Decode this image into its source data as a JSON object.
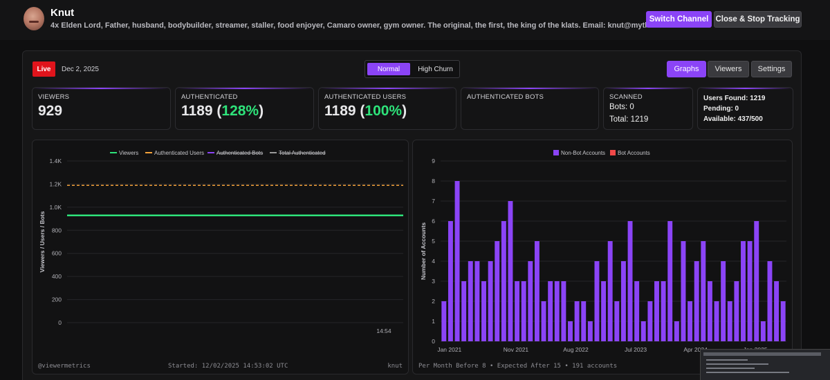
{
  "header": {
    "channel_name": "Knut",
    "bio": "4x Elden Lord, Father, husband, bodybuilder, streamer, staller, food enjoyer, Camaro owner, gym owner. The original, the first, the king of the klats. Email: knut@mythictalent.com",
    "switch_label": "Switch Channel",
    "close_label": "Close & Stop Tracking"
  },
  "status": {
    "live_label": "Live",
    "date": "Dec 2, 2025"
  },
  "mode": {
    "normal": "Normal",
    "high_churn": "High Churn",
    "selected": "Normal"
  },
  "tabs": [
    {
      "label": "Graphs",
      "active": true
    },
    {
      "label": "Viewers"
    },
    {
      "label": "Settings"
    }
  ],
  "stats": {
    "viewers": {
      "label": "VIEWERS",
      "value": "929"
    },
    "authenticated": {
      "label": "AUTHENTICATED",
      "value": "1189",
      "pct": "128%"
    },
    "authenticated_users": {
      "label": "AUTHENTICATED USERS",
      "value": "1189",
      "pct": "100%"
    },
    "authenticated_bots": {
      "label": "AUTHENTICATED BOTS",
      "value": ""
    },
    "scanned": {
      "label": "SCANNED",
      "bots": "Bots: 0",
      "total": "Total: 1219"
    },
    "users": {
      "found": "Users Found: 1219",
      "pending": "Pending: 0",
      "available": "Available: 437/500"
    }
  },
  "colors": {
    "accent": "#8b44f7",
    "live": "#e0141c",
    "green": "#2ee37a",
    "orange": "#f5a33b",
    "red": "#f04848",
    "grey": "#9a9a9a"
  },
  "chart_data": [
    {
      "type": "line",
      "legend": [
        "Viewers",
        "Authenticated Users",
        "Authenticated Bots",
        "Total Authenticated"
      ],
      "legend_struck": [
        false,
        false,
        true,
        true
      ],
      "legend_position": "top",
      "ylabel": "Viewers / Users / Bots",
      "yticks": [
        "0",
        "200",
        "400",
        "600",
        "800",
        "1.0K",
        "1.2K",
        "1.4K"
      ],
      "ylim": [
        0,
        1400
      ],
      "xtick": "14:54",
      "series": [
        {
          "name": "Viewers",
          "value": 929,
          "color": "#2ee37a",
          "style": "solid"
        },
        {
          "name": "Authenticated Users",
          "value": 1189,
          "color": "#f5a33b",
          "style": "dashed"
        }
      ],
      "grid": true,
      "footer": {
        "left": "@viewermetrics",
        "center": "Started: 12/02/2025 14:53:02 UTC",
        "right": "knut"
      }
    },
    {
      "type": "bar",
      "legend": [
        "Non-Bot Accounts",
        "Bot Accounts"
      ],
      "legend_colors": [
        "#8b44f7",
        "#f04848"
      ],
      "legend_position": "top",
      "ylabel": "Number of Accounts",
      "ylim": [
        0,
        9
      ],
      "yticks": [
        "0",
        "1",
        "2",
        "3",
        "4",
        "5",
        "6",
        "7",
        "8",
        "9"
      ],
      "xticks": [
        "Jan 2021",
        "Nov 2021",
        "Aug 2022",
        "Jul 2023",
        "Apr 2024",
        "Jan 2025"
      ],
      "xtick_indices": [
        0,
        10,
        19,
        28,
        37,
        46
      ],
      "values": [
        2,
        6,
        8,
        3,
        4,
        4,
        3,
        4,
        5,
        6,
        7,
        3,
        3,
        4,
        5,
        2,
        3,
        3,
        3,
        1,
        2,
        2,
        1,
        4,
        3,
        5,
        2,
        4,
        6,
        3,
        1,
        2,
        3,
        3,
        6,
        1,
        5,
        2,
        4,
        5,
        3,
        2,
        4,
        2,
        3,
        5,
        5,
        6,
        1,
        4,
        3,
        2
      ],
      "bot_values": [],
      "grid": true,
      "footer": "Per Month Before 8 • Expected After 15 • 191 accounts"
    }
  ]
}
